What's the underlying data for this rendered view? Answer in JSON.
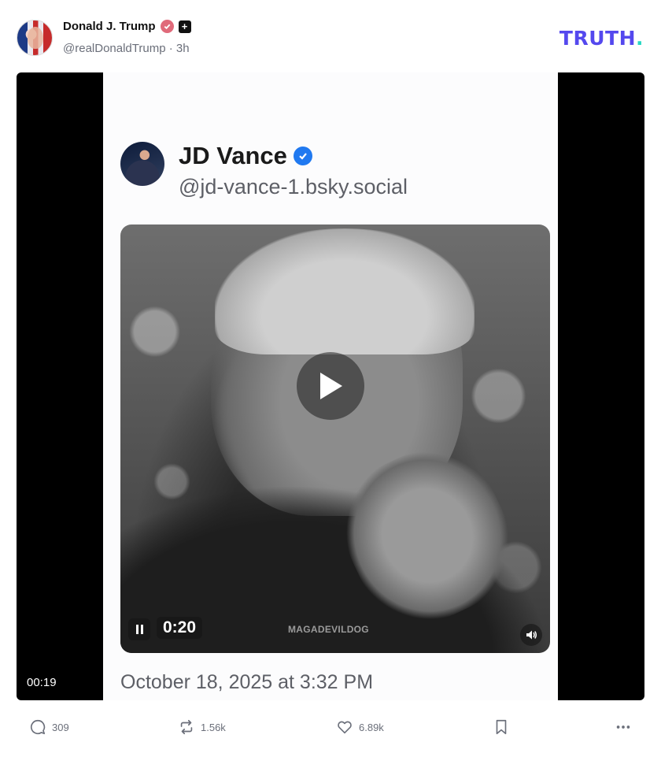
{
  "post": {
    "author_name": "Donald J. Trump",
    "handle": "@realDonaldTrump · 3h",
    "verified_icon": "verified-badge-icon",
    "plus_icon": "plus-badge-icon",
    "plus_label": "+"
  },
  "brand": {
    "logo_text": "TRUTH",
    "logo_dot": ".",
    "logo_color": "#5448ee",
    "dot_color": "#27d8c4"
  },
  "media": {
    "elapsed": "00:19",
    "embedded": {
      "name": "JD Vance",
      "handle": "@jd-vance-1.bsky.social",
      "verified_color": "#2079f0",
      "video_time": "0:20",
      "watermark": "MAGADEVILDOG",
      "date": "October 18, 2025 at 3:32 PM"
    }
  },
  "actions": {
    "replies": "309",
    "retruths": "1.56k",
    "likes": "6.89k"
  }
}
